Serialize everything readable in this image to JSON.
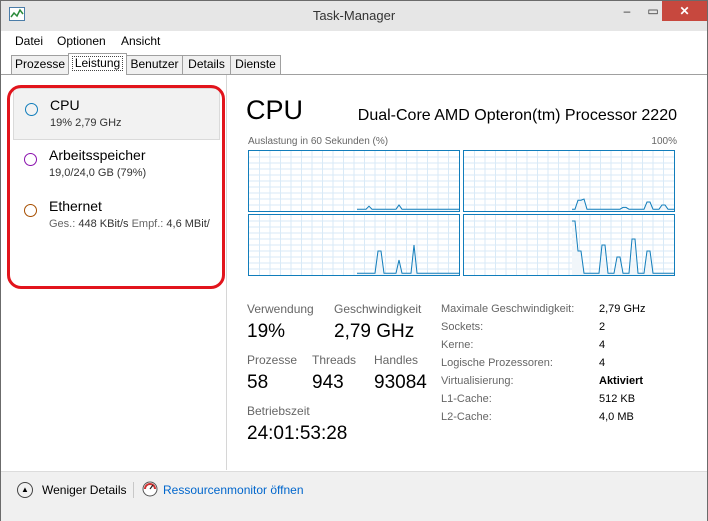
{
  "window": {
    "title": "Task-Manager"
  },
  "controls": {
    "minimize": "–",
    "maximize": "▭",
    "close": "✕"
  },
  "menu": [
    "Datei",
    "Optionen",
    "Ansicht"
  ],
  "tabs": [
    "Prozesse",
    "Leistung",
    "Benutzer",
    "Details",
    "Dienste"
  ],
  "active_tab": "Leistung",
  "sidebar": {
    "items": [
      {
        "title": "CPU",
        "sub": "19% 2,79 GHz",
        "color": "#117dbb",
        "selected": true
      },
      {
        "title": "Arbeitsspeicher",
        "sub": "19,0/24,0 GB (79%)",
        "color": "#8b12ae"
      },
      {
        "title": "Ethernet",
        "sub_label1": "Ges.:",
        "sub_val1": "448 KBit/s",
        "sub_label2": "Empf.:",
        "sub_val2": "4,6 MBit/",
        "color": "#a74f01"
      }
    ]
  },
  "cpu": {
    "title": "CPU",
    "model": "Dual-Core AMD Opteron(tm) Processor 2220",
    "graph_label": "Auslastung in 60 Sekunden (%)",
    "graph_max": "100%"
  },
  "stats": {
    "verwendung_label": "Verwendung",
    "verwendung": "19%",
    "geschw_label": "Geschwindigkeit",
    "geschw": "2,79 GHz",
    "prozesse_label": "Prozesse",
    "prozesse": "58",
    "threads_label": "Threads",
    "threads": "943",
    "handles_label": "Handles",
    "handles": "93084",
    "betrieb_label": "Betriebszeit",
    "betrieb": "24:01:53:28"
  },
  "specs": [
    {
      "label": "Maximale Geschwindigkeit:",
      "value": "2,79 GHz"
    },
    {
      "label": "Sockets:",
      "value": "2"
    },
    {
      "label": "Kerne:",
      "value": "4"
    },
    {
      "label": "Logische Prozessoren:",
      "value": "4"
    },
    {
      "label": "Virtualisierung:",
      "value": "Aktiviert",
      "bold": true
    },
    {
      "label": "L1-Cache:",
      "value": "512 KB"
    },
    {
      "label": "L2-Cache:",
      "value": "4,0 MB"
    }
  ],
  "footer": {
    "fewer_details": "Weniger Details",
    "resmon": "Ressourcenmonitor öffnen"
  },
  "accent": "#117dbb",
  "highlight": "#e2141c",
  "core_graphs": [
    [
      0,
      0,
      0,
      0,
      0,
      0,
      0,
      0,
      0,
      0,
      0,
      0,
      0,
      0,
      0,
      0,
      0,
      0,
      0,
      0,
      0,
      0,
      0,
      0,
      0,
      0,
      0,
      0,
      0,
      0,
      0,
      0,
      0,
      0,
      0,
      0,
      0,
      0,
      0,
      0,
      0,
      0,
      0,
      0,
      0,
      0,
      0,
      0,
      0,
      0,
      0,
      0,
      0,
      0,
      0,
      0,
      0,
      0,
      0,
      0
    ],
    [
      0,
      0,
      0,
      0,
      0,
      0,
      0,
      0,
      0,
      0,
      0,
      0,
      0,
      0,
      0,
      0,
      0,
      0,
      0,
      0,
      0,
      0,
      0,
      0,
      0,
      0,
      0,
      0,
      0,
      0,
      0,
      0,
      0,
      0,
      0,
      0,
      0,
      0,
      0,
      0,
      0,
      0,
      0,
      0,
      0,
      0,
      0,
      0,
      0,
      0,
      0,
      0,
      0,
      0,
      0,
      0,
      0,
      0,
      0,
      0
    ],
    [
      0,
      0,
      0,
      0,
      0,
      0,
      0,
      0,
      0,
      0,
      0,
      0,
      0,
      0,
      0,
      0,
      0,
      0,
      0,
      0,
      0,
      0,
      0,
      0,
      0,
      0,
      0,
      0,
      0,
      0,
      0,
      0,
      0,
      0,
      0,
      0,
      0,
      0,
      0,
      0,
      0,
      0,
      0,
      0,
      0,
      0,
      0,
      0,
      0,
      0,
      0,
      0,
      0,
      0,
      0,
      0,
      0,
      0,
      0,
      0
    ],
    [
      0,
      0,
      0,
      0,
      0,
      0,
      0,
      0,
      0,
      0,
      0,
      0,
      0,
      0,
      0,
      0,
      0,
      0,
      0,
      0,
      0,
      0,
      0,
      0,
      0,
      0,
      0,
      0,
      0,
      0,
      0,
      0,
      0,
      0,
      0,
      0,
      0,
      0,
      0,
      0,
      0,
      0,
      0,
      0,
      0,
      0,
      0,
      0,
      0,
      0,
      0,
      0,
      0,
      0,
      0,
      0,
      0,
      0,
      0,
      0
    ]
  ]
}
